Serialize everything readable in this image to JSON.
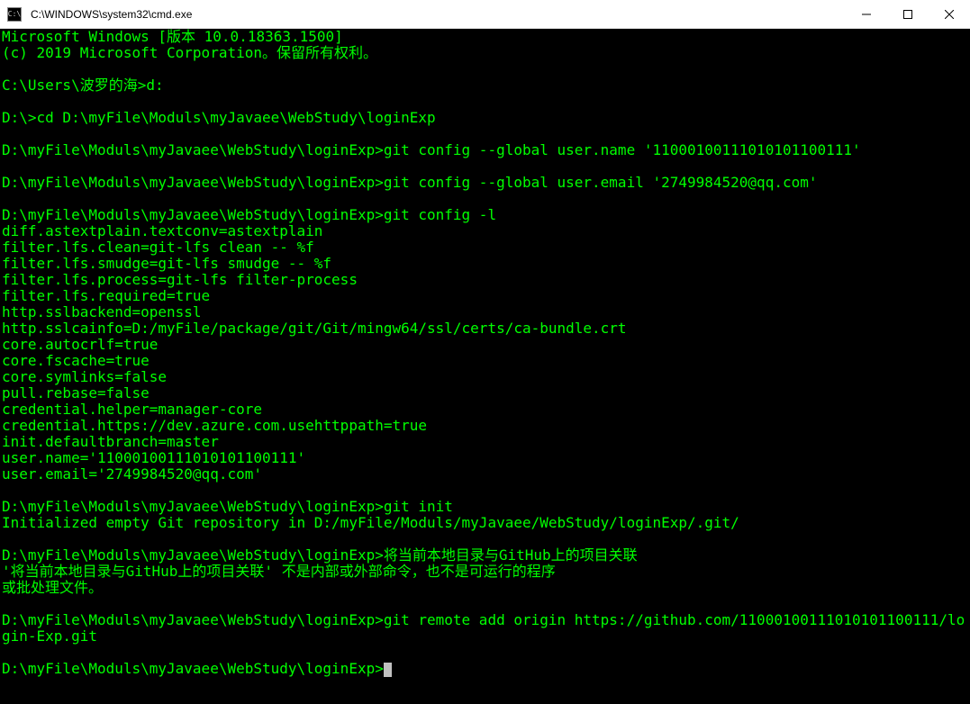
{
  "window": {
    "title": "C:\\WINDOWS\\system32\\cmd.exe",
    "icon_label": "C:\\"
  },
  "terminal": {
    "lines": [
      {
        "type": "out",
        "text": "Microsoft Windows [版本 10.0.18363.1500]"
      },
      {
        "type": "out",
        "text": "(c) 2019 Microsoft Corporation。保留所有权利。"
      },
      {
        "type": "blank",
        "text": ""
      },
      {
        "type": "cmd",
        "prompt": "C:\\Users\\波罗的海>",
        "command": "d:"
      },
      {
        "type": "blank",
        "text": ""
      },
      {
        "type": "cmd",
        "prompt": "D:\\>",
        "command": "cd D:\\myFile\\Moduls\\myJavaee\\WebStudy\\loginExp"
      },
      {
        "type": "blank",
        "text": ""
      },
      {
        "type": "cmd",
        "prompt": "D:\\myFile\\Moduls\\myJavaee\\WebStudy\\loginExp>",
        "command": "git config --global user.name '11000100111010101100111'"
      },
      {
        "type": "blank",
        "text": ""
      },
      {
        "type": "cmd",
        "prompt": "D:\\myFile\\Moduls\\myJavaee\\WebStudy\\loginExp>",
        "command": "git config --global user.email '2749984520@qq.com'"
      },
      {
        "type": "blank",
        "text": ""
      },
      {
        "type": "cmd",
        "prompt": "D:\\myFile\\Moduls\\myJavaee\\WebStudy\\loginExp>",
        "command": "git config -l"
      },
      {
        "type": "out",
        "text": "diff.astextplain.textconv=astextplain"
      },
      {
        "type": "out",
        "text": "filter.lfs.clean=git-lfs clean -- %f"
      },
      {
        "type": "out",
        "text": "filter.lfs.smudge=git-lfs smudge -- %f"
      },
      {
        "type": "out",
        "text": "filter.lfs.process=git-lfs filter-process"
      },
      {
        "type": "out",
        "text": "filter.lfs.required=true"
      },
      {
        "type": "out",
        "text": "http.sslbackend=openssl"
      },
      {
        "type": "out",
        "text": "http.sslcainfo=D:/myFile/package/git/Git/mingw64/ssl/certs/ca-bundle.crt"
      },
      {
        "type": "out",
        "text": "core.autocrlf=true"
      },
      {
        "type": "out",
        "text": "core.fscache=true"
      },
      {
        "type": "out",
        "text": "core.symlinks=false"
      },
      {
        "type": "out",
        "text": "pull.rebase=false"
      },
      {
        "type": "out",
        "text": "credential.helper=manager-core"
      },
      {
        "type": "out",
        "text": "credential.https://dev.azure.com.usehttppath=true"
      },
      {
        "type": "out",
        "text": "init.defaultbranch=master"
      },
      {
        "type": "out",
        "text": "user.name='11000100111010101100111'"
      },
      {
        "type": "out",
        "text": "user.email='2749984520@qq.com'"
      },
      {
        "type": "blank",
        "text": ""
      },
      {
        "type": "cmd",
        "prompt": "D:\\myFile\\Moduls\\myJavaee\\WebStudy\\loginExp>",
        "command": "git init"
      },
      {
        "type": "out",
        "text": "Initialized empty Git repository in D:/myFile/Moduls/myJavaee/WebStudy/loginExp/.git/"
      },
      {
        "type": "blank",
        "text": ""
      },
      {
        "type": "cmd",
        "prompt": "D:\\myFile\\Moduls\\myJavaee\\WebStudy\\loginExp>",
        "command": "将当前本地目录与GitHub上的项目关联"
      },
      {
        "type": "out",
        "text": "'将当前本地目录与GitHub上的项目关联' 不是内部或外部命令，也不是可运行的程序"
      },
      {
        "type": "out",
        "text": "或批处理文件。"
      },
      {
        "type": "blank",
        "text": ""
      },
      {
        "type": "cmd",
        "prompt": "D:\\myFile\\Moduls\\myJavaee\\WebStudy\\loginExp>",
        "command": "git remote add origin https://github.com/11000100111010101100111/login-Exp.git"
      },
      {
        "type": "blank",
        "text": ""
      },
      {
        "type": "cmd_cursor",
        "prompt": "D:\\myFile\\Moduls\\myJavaee\\WebStudy\\loginExp>",
        "command": ""
      }
    ]
  }
}
